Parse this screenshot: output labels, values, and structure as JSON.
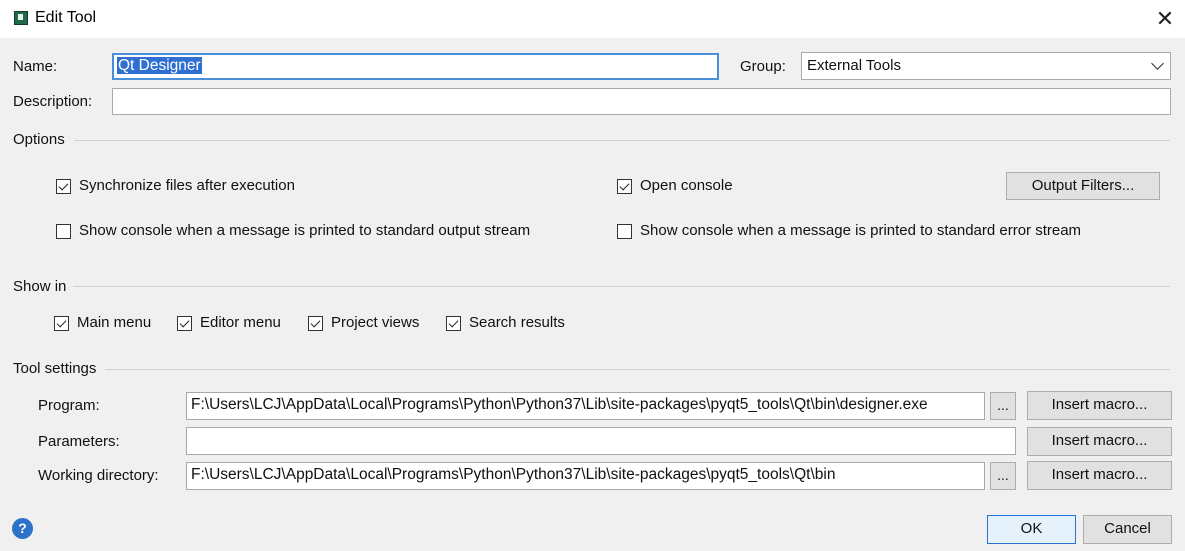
{
  "window": {
    "title": "Edit Tool",
    "close_symbol": "✕"
  },
  "form": {
    "name_label": "Name:",
    "name_value": "Qt Designer",
    "group_label": "Group:",
    "group_value": "External Tools",
    "description_label": "Description:",
    "description_value": ""
  },
  "options": {
    "heading": "Options",
    "sync_files": {
      "label": "Synchronize files after execution",
      "checked": true
    },
    "open_console": {
      "label": "Open console",
      "checked": true
    },
    "output_filters_button": "Output Filters...",
    "show_console_stdout": {
      "label": "Show console when a message is printed to standard output stream",
      "checked": false
    },
    "show_console_stderr": {
      "label": "Show console when a message is printed to standard error stream",
      "checked": false
    }
  },
  "show_in": {
    "heading": "Show in",
    "items": [
      {
        "label": "Main menu",
        "checked": true
      },
      {
        "label": "Editor menu",
        "checked": true
      },
      {
        "label": "Project views",
        "checked": true
      },
      {
        "label": "Search results",
        "checked": true
      }
    ]
  },
  "tool_settings": {
    "heading": "Tool settings",
    "program_label": "Program:",
    "program_value": "F:\\Users\\LCJ\\AppData\\Local\\Programs\\Python\\Python37\\Lib\\site-packages\\pyqt5_tools\\Qt\\bin\\designer.exe",
    "parameters_label": "Parameters:",
    "parameters_value": "",
    "working_dir_label": "Working directory:",
    "working_dir_value": "F:\\Users\\LCJ\\AppData\\Local\\Programs\\Python\\Python37\\Lib\\site-packages\\pyqt5_tools\\Qt\\bin",
    "browse_label": "...",
    "insert_macro_label": "Insert macro..."
  },
  "footer": {
    "help_symbol": "?",
    "ok_label": "OK",
    "cancel_label": "Cancel"
  },
  "colors": {
    "accent": "#2f6fd1",
    "background": "#f0f0f0",
    "help_icon": "#2d73c9"
  }
}
